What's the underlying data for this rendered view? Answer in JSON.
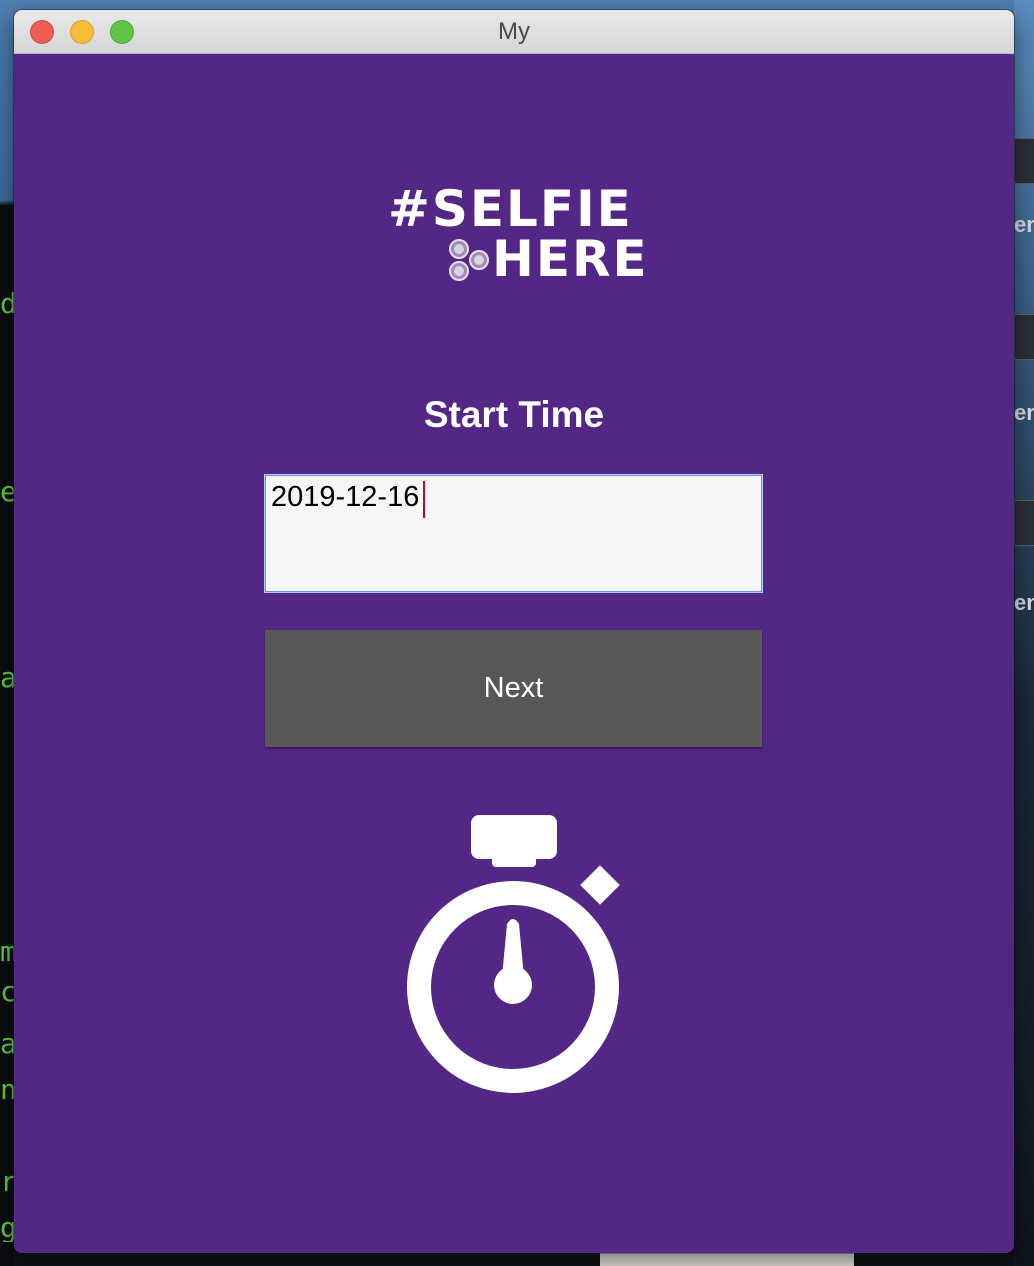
{
  "window": {
    "title": "My"
  },
  "logo": {
    "line1": "#SELFIE",
    "line2": "HERE"
  },
  "form": {
    "heading": "Start Time",
    "date_value": "2019-12-16",
    "next_label": "Next"
  },
  "icons": {
    "stopwatch": "stopwatch-icon",
    "logo_dots": "dots-icon"
  },
  "background": {
    "terminal_letters": [
      "d",
      "e",
      "a",
      "m",
      "c",
      "a",
      "n",
      "r",
      "g"
    ],
    "side_labels": [
      "en",
      "en",
      "en"
    ]
  },
  "colors": {
    "content_background": "#522785",
    "button_background": "#575757",
    "input_background": "#f6f6f7",
    "input_border": "#6b8ff0",
    "caret": "#d0021b",
    "close": "#ee5e57",
    "minimize": "#f6bd3b",
    "zoom": "#5fc645"
  }
}
